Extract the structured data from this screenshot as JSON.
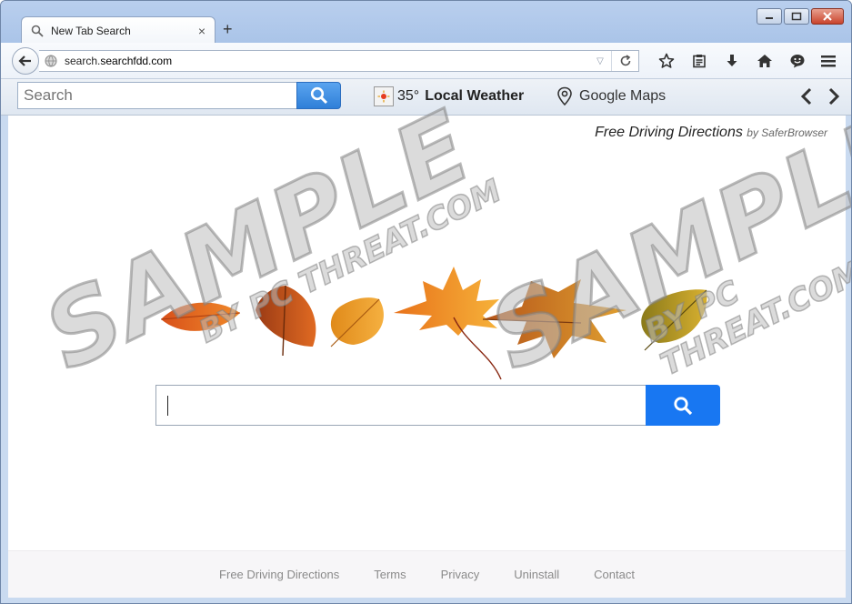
{
  "browser": {
    "tab_title": "New Tab Search",
    "tab_close": "×",
    "new_tab": "+",
    "url_prefix": "search.",
    "url_host": "searchfdd.com"
  },
  "toolbar": {
    "search_placeholder": "Search",
    "weather_temp": "35°",
    "weather_label": "Local Weather",
    "maps_label": "Google Maps"
  },
  "page": {
    "brand_link": "Free Driving Directions",
    "brand_by": "by SaferBrowser",
    "search_value": ""
  },
  "footer": {
    "links": [
      "Free Driving Directions",
      "Terms",
      "Privacy",
      "Uninstall",
      "Contact"
    ]
  },
  "watermark": {
    "big": "SAMPLE",
    "small": "BY PC THREAT.COM"
  },
  "colors": {
    "search_button": "#1877f2",
    "toolbar_search_button": "#2f7fd8",
    "footer_bg": "#f7f6f8"
  }
}
